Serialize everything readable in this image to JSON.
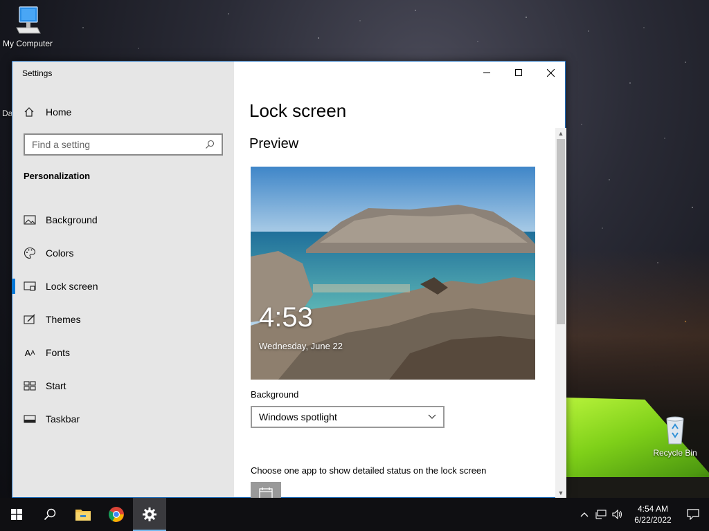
{
  "desktop": {
    "icons": [
      {
        "name": "My Computer",
        "icon": "computer-icon"
      },
      {
        "name": "Recycle Bin",
        "icon": "recycle-bin-icon"
      }
    ],
    "partial_label": "Da"
  },
  "window": {
    "title": "Settings",
    "home_label": "Home",
    "search_placeholder": "Find a setting",
    "section_title": "Personalization",
    "nav_items": [
      {
        "label": "Background",
        "icon": "picture-icon"
      },
      {
        "label": "Colors",
        "icon": "palette-icon"
      },
      {
        "label": "Lock screen",
        "icon": "lock-screen-icon",
        "active": true
      },
      {
        "label": "Themes",
        "icon": "themes-icon"
      },
      {
        "label": "Fonts",
        "icon": "fonts-icon"
      },
      {
        "label": "Start",
        "icon": "start-icon"
      },
      {
        "label": "Taskbar",
        "icon": "taskbar-icon"
      }
    ]
  },
  "content": {
    "page_title": "Lock screen",
    "preview_heading": "Preview",
    "preview_time": "4:53",
    "preview_date": "Wednesday, June 22",
    "background_label": "Background",
    "background_value": "Windows spotlight",
    "status_app_label": "Choose one app to show detailed status on the lock screen"
  },
  "taskbar": {
    "apps": [
      "start-icon",
      "search-icon",
      "file-explorer-icon",
      "chrome-icon",
      "settings-icon"
    ],
    "active_app": "settings-icon",
    "time": "4:54 AM",
    "date": "6/22/2022"
  },
  "colors": {
    "accent": "#0078d7",
    "sidebar_bg": "#e6e6e6",
    "taskbar_bg": "#0f0f12"
  }
}
